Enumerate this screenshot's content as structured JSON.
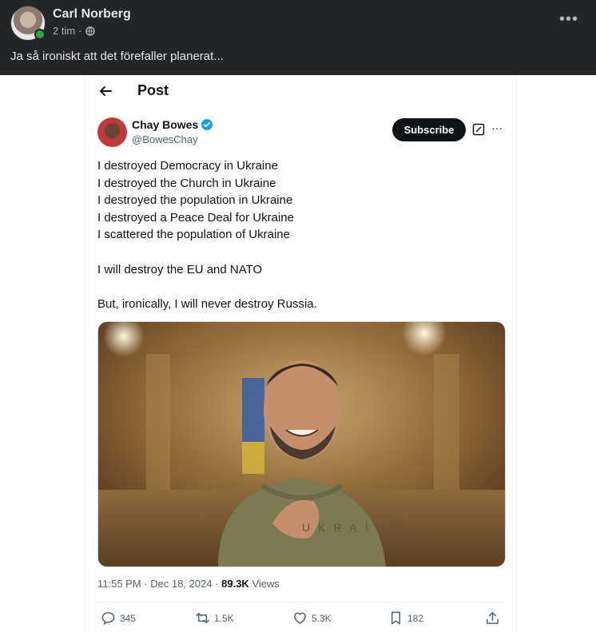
{
  "fb_post": {
    "author": "Carl Norberg",
    "time": "2 tim",
    "separator": "·",
    "caption": "Ja så ironiskt att det förefaller planerat...",
    "more": "•••"
  },
  "embedded_tweet": {
    "header_title": "Post",
    "author_name": "Chay Bowes",
    "author_handle": "@BowesChay",
    "subscribe_label": "Subscribe",
    "more": "···",
    "lines": [
      "I destroyed Democracy in Ukraine",
      "I destroyed the Church in Ukraine",
      "I destroyed the population in Ukraine",
      "I destroyed a Peace Deal for Ukraine",
      "I scattered the population of Ukraine"
    ],
    "line_6": "I will destroy the EU and NATO",
    "line_7": "But, ironically, I will never destroy Russia.",
    "sweater_text": "UKRAINE",
    "timestamp": "11:55 PM · Dec 18, 2024 · ",
    "views_count": "89.3K",
    "views_label": " Views",
    "actions": {
      "replies": "345",
      "reposts": "1.5K",
      "likes": "5.3K",
      "bookmarks": "182"
    }
  },
  "colors": {
    "fb_bg": "#242526",
    "fb_text": "#e4e6eb",
    "x_text": "#0f1419",
    "x_muted": "#536471",
    "verified_blue": "#1d9bf0",
    "online_green": "#31a24c"
  }
}
